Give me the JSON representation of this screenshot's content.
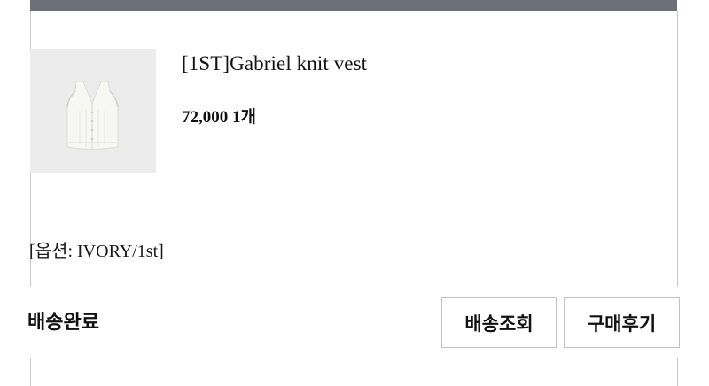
{
  "order_item": {
    "product_name": "[1ST]Gabriel knit vest",
    "price": "72,000",
    "quantity": "1개",
    "option": "[옵션: IVORY/1st]",
    "thumbnail_icon": "knit-vest-image"
  },
  "status": {
    "label": "배송완료"
  },
  "actions": {
    "track_label": "배송조회",
    "review_label": "구매후기"
  },
  "colors": {
    "header_bar": "#6d7079",
    "border": "#c2c2c2",
    "thumbnail_bg": "#ececec"
  }
}
